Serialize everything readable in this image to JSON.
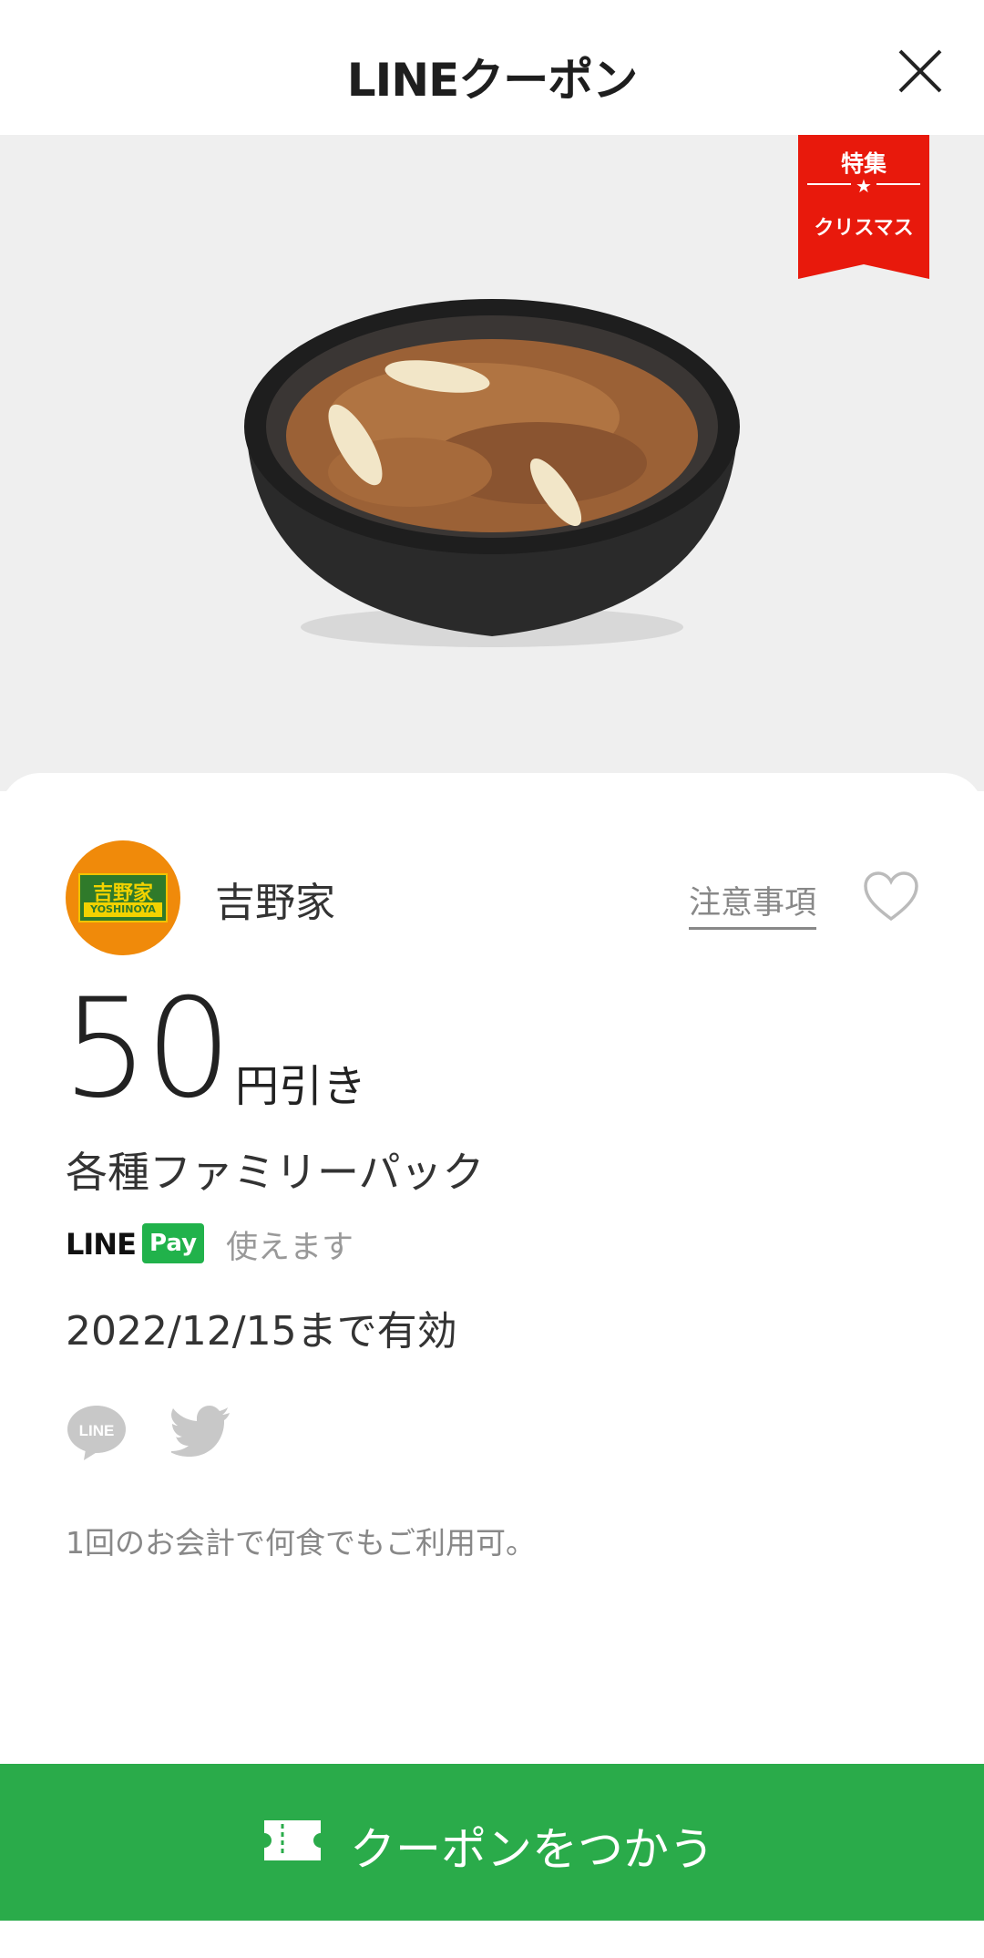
{
  "header": {
    "title": "LINEクーポン",
    "close_icon": "close-icon"
  },
  "hero": {
    "ribbon_top": "特集",
    "ribbon_star": "★",
    "ribbon_bottom": "クリスマス",
    "ribbon_color": "#e8190c"
  },
  "store": {
    "logo_text_jp": "吉野家",
    "logo_text_en": "YOSHINOYA",
    "name": "吉野家",
    "notes_label": "注意事項"
  },
  "coupon": {
    "amount": "50",
    "unit": "円引き",
    "product": "各種ファミリーパック",
    "pay_logo_line": "LINE",
    "pay_logo_pay": "Pay",
    "pay_available": "使えます",
    "validity": "2022/12/15まで有効",
    "usage_note": "1回のお会計で何食でもご利用可。"
  },
  "share": {
    "line_icon_text": "LINE"
  },
  "cta": {
    "label": "クーポンをつかう",
    "color": "#2aab4a"
  }
}
